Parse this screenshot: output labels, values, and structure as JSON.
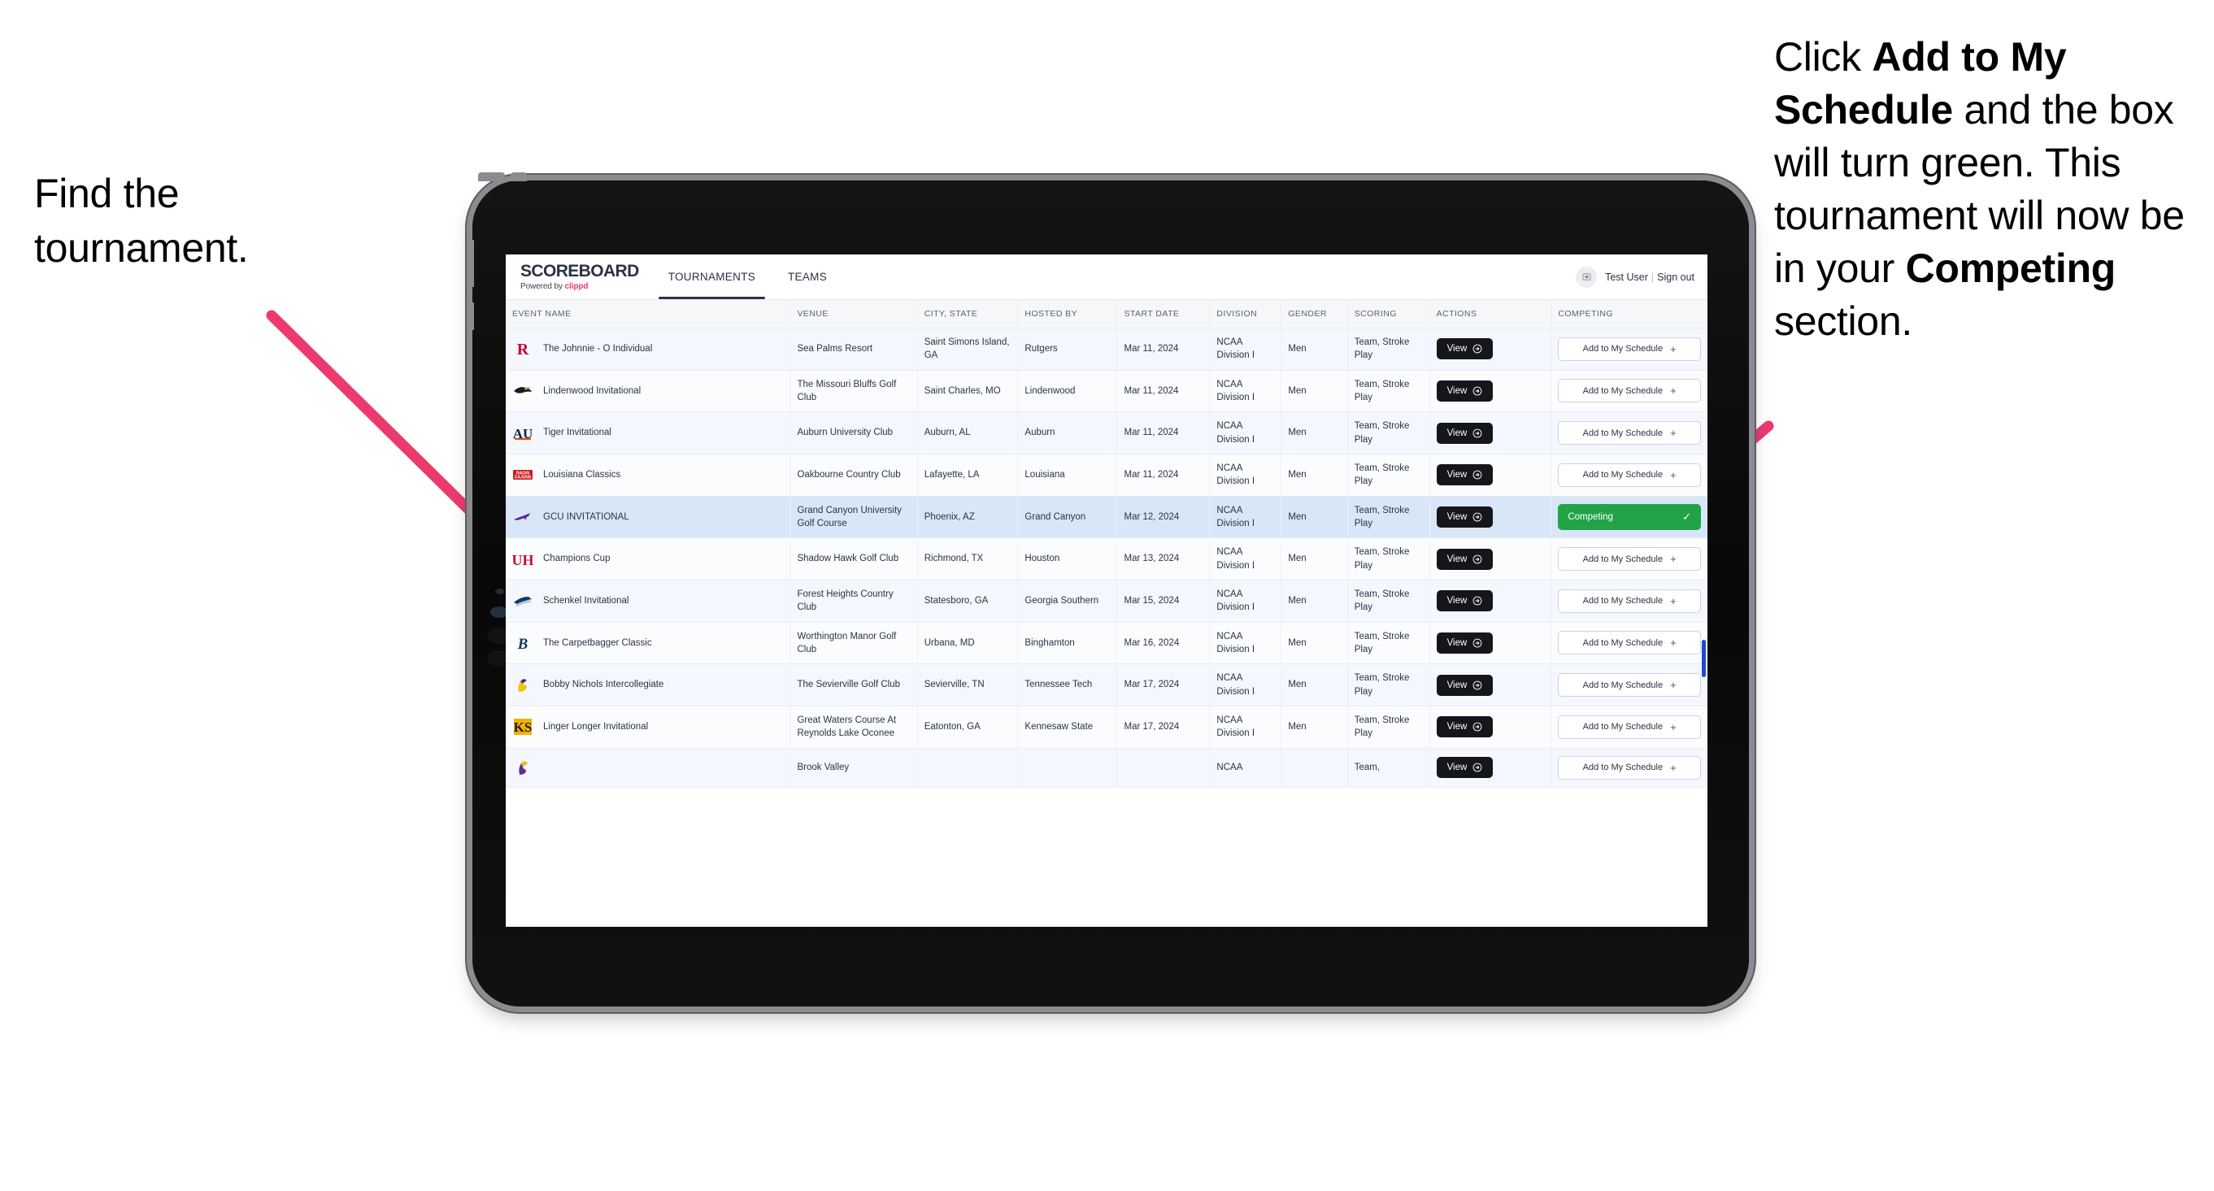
{
  "annotations": {
    "left": {
      "line1": "Find the",
      "line2": "tournament."
    },
    "right": {
      "p1_pre": "Click ",
      "p1_bold": "Add to My Schedule",
      "p1_post": " and the box will turn green. This tournament will now be in your ",
      "p2_bold": "Competing",
      "p2_post": " section."
    },
    "arrow_color": "#ec3a6e"
  },
  "app": {
    "brand": {
      "title": "SCOREBOARD",
      "powered_prefix": "Powered by ",
      "powered_brand": "clippd",
      "brand_color": "#ec3a6e"
    },
    "nav": [
      {
        "label": "TOURNAMENTS",
        "active": true
      },
      {
        "label": "TEAMS",
        "active": false
      }
    ],
    "user": {
      "avatar_icon": "user-badge-icon",
      "name": "Test User",
      "separator": "|",
      "sign_out": "Sign out"
    },
    "table": {
      "columns": [
        "EVENT NAME",
        "VENUE",
        "CITY, STATE",
        "HOSTED BY",
        "START DATE",
        "DIVISION",
        "GENDER",
        "SCORING",
        "ACTIONS",
        "COMPETING"
      ],
      "action_label": "View",
      "add_label": "Add to My Schedule",
      "add_plus": "+",
      "competing_label": "Competing",
      "competing_check": "✓",
      "competing_color": "#23a348",
      "rows": [
        {
          "logo": "rutgers-logo",
          "event": "The Johnnie - O Individual",
          "venue": "Sea Palms Resort",
          "city": "Saint Simons Island, GA",
          "host": "Rutgers",
          "date": "Mar 11, 2024",
          "division": "NCAA Division I",
          "gender": "Men",
          "scoring": "Team, Stroke Play",
          "competing": false
        },
        {
          "logo": "lindenwood-logo",
          "event": "Lindenwood Invitational",
          "venue": "The Missouri Bluffs Golf Club",
          "city": "Saint Charles, MO",
          "host": "Lindenwood",
          "date": "Mar 11, 2024",
          "division": "NCAA Division I",
          "gender": "Men",
          "scoring": "Team, Stroke Play",
          "competing": false
        },
        {
          "logo": "auburn-logo",
          "event": "Tiger Invitational",
          "venue": "Auburn University Club",
          "city": "Auburn, AL",
          "host": "Auburn",
          "date": "Mar 11, 2024",
          "division": "NCAA Division I",
          "gender": "Men",
          "scoring": "Team, Stroke Play",
          "competing": false
        },
        {
          "logo": "louisiana-logo",
          "event": "Louisiana Classics",
          "venue": "Oakbourne Country Club",
          "city": "Lafayette, LA",
          "host": "Louisiana",
          "date": "Mar 11, 2024",
          "division": "NCAA Division I",
          "gender": "Men",
          "scoring": "Team, Stroke Play",
          "competing": false
        },
        {
          "logo": "grandcanyon-logo",
          "event": "GCU INVITATIONAL",
          "venue": "Grand Canyon University Golf Course",
          "city": "Phoenix, AZ",
          "host": "Grand Canyon",
          "date": "Mar 12, 2024",
          "division": "NCAA Division I",
          "gender": "Men",
          "scoring": "Team, Stroke Play",
          "competing": true
        },
        {
          "logo": "houston-logo",
          "event": "Champions Cup",
          "venue": "Shadow Hawk Golf Club",
          "city": "Richmond, TX",
          "host": "Houston",
          "date": "Mar 13, 2024",
          "division": "NCAA Division I",
          "gender": "Men",
          "scoring": "Team, Stroke Play",
          "competing": false
        },
        {
          "logo": "georgiasouthern-logo",
          "event": "Schenkel Invitational",
          "venue": "Forest Heights Country Club",
          "city": "Statesboro, GA",
          "host": "Georgia Southern",
          "date": "Mar 15, 2024",
          "division": "NCAA Division I",
          "gender": "Men",
          "scoring": "Team, Stroke Play",
          "competing": false
        },
        {
          "logo": "binghamton-logo",
          "event": "The Carpetbagger Classic",
          "venue": "Worthington Manor Golf Club",
          "city": "Urbana, MD",
          "host": "Binghamton",
          "date": "Mar 16, 2024",
          "division": "NCAA Division I",
          "gender": "Men",
          "scoring": "Team, Stroke Play",
          "competing": false
        },
        {
          "logo": "tennesseetech-logo",
          "event": "Bobby Nichols Intercollegiate",
          "venue": "The Sevierville Golf Club",
          "city": "Sevierville, TN",
          "host": "Tennessee Tech",
          "date": "Mar 17, 2024",
          "division": "NCAA Division I",
          "gender": "Men",
          "scoring": "Team, Stroke Play",
          "competing": false
        },
        {
          "logo": "kennesawstate-logo",
          "event": "Linger Longer Invitational",
          "venue": "Great Waters Course At Reynolds Lake Oconee",
          "city": "Eatonton, GA",
          "host": "Kennesaw State",
          "date": "Mar 17, 2024",
          "division": "NCAA Division I",
          "gender": "Men",
          "scoring": "Team, Stroke Play",
          "competing": false
        },
        {
          "logo": "eastcarolina-logo",
          "event": "",
          "venue": "Brook Valley",
          "city": "",
          "host": "",
          "date": "",
          "division": "NCAA",
          "gender": "",
          "scoring": "Team,",
          "competing": false
        }
      ]
    }
  }
}
